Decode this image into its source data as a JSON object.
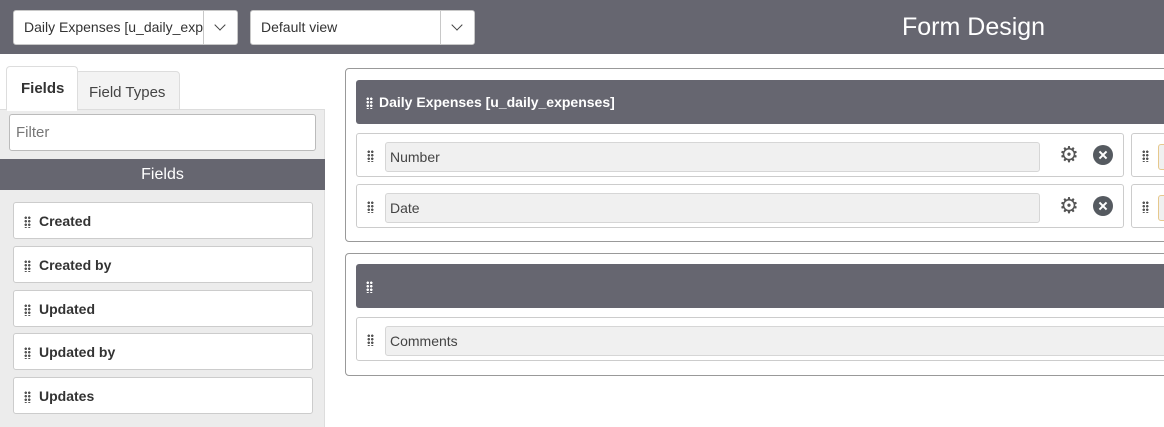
{
  "header": {
    "table_select": {
      "value": "Daily Expenses [u_daily_expenses]"
    },
    "view_select": {
      "value": "Default view"
    },
    "title": "Form Design"
  },
  "sidebar": {
    "tabs": [
      {
        "label": "Fields",
        "active": true
      },
      {
        "label": "Field Types",
        "active": false
      }
    ],
    "filter": {
      "placeholder": "Filter",
      "value": ""
    },
    "fields_header": "Fields",
    "items": [
      {
        "label": "Created"
      },
      {
        "label": "Created by"
      },
      {
        "label": "Updated"
      },
      {
        "label": "Updated by"
      },
      {
        "label": "Updates"
      }
    ]
  },
  "canvas": {
    "sections": [
      {
        "title": "Daily Expenses [u_daily_expenses]",
        "fields": [
          {
            "label": "Number"
          },
          {
            "label": "Date"
          }
        ]
      },
      {
        "title": "",
        "fields": [
          {
            "label": "Comments"
          }
        ]
      }
    ]
  },
  "colors": {
    "header_bg": "#666670",
    "sidebar_bg": "#ececec"
  },
  "icons": [
    "chevron-down-icon",
    "drag-handle-icon",
    "gear-icon",
    "close-icon"
  ]
}
